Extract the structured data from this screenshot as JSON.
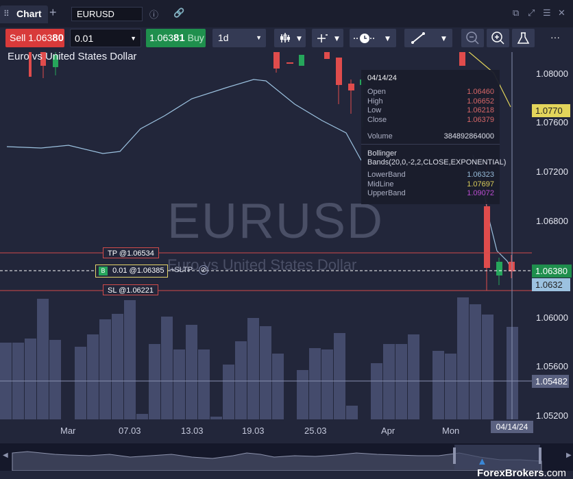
{
  "window": {
    "tab_title": "Chart",
    "symbol": "EURUSD",
    "info_icon": "info-icon",
    "link_icon": "link-icon"
  },
  "toolbar": {
    "sell_label": "Sell",
    "sell_price_main": "1.063",
    "sell_price_pips": "80",
    "quantity": "0.01",
    "buy_price_main": "1.063",
    "buy_price_pips": "81",
    "buy_label": "Buy",
    "timeframe": "1d",
    "more": "···"
  },
  "chart": {
    "title": "Euro vs United States Dollar",
    "watermark_symbol": "EURUSD",
    "watermark_name": "Euro vs United States Dollar",
    "tp_label": "TP @1.06534",
    "position_badge": "B",
    "position_label": "0.01 @1.06385",
    "sltp_label": "+SLTP",
    "sl_label": "SL @1.06221",
    "y_axis": [
      "1.08000",
      "1.07600",
      "1.07200",
      "1.06800",
      "1.06000",
      "1.05600",
      "1.05200"
    ],
    "tags": {
      "midline": "1.0770",
      "price": "1.06380",
      "lower": "1.0632",
      "crosshair": "1.05482"
    },
    "x_axis": [
      "Mar",
      "07.03",
      "13.03",
      "19.03",
      "25.03",
      "Apr",
      "Mon"
    ],
    "crosshair_date": "04/14/24",
    "colors": {
      "up": "#26a65b",
      "down": "#e04c4c",
      "volume": "#444b6c",
      "band": "#9cc2e0",
      "midline": "#e3d55b"
    }
  },
  "tooltip": {
    "date": "04/14/24",
    "open_label": "Open",
    "open": "1.06460",
    "high_label": "High",
    "high": "1.06652",
    "low_label": "Low",
    "low": "1.06218",
    "close_label": "Close",
    "close": "1.06379",
    "volume_label": "Volume",
    "volume": "384892864000",
    "indicator_line1": "Bollinger",
    "indicator_line2": "Bands(20,0,-2,2,CLOSE,EXPONENTIAL)",
    "lower_label": "LowerBand",
    "lower": "1.06323",
    "mid_label": "MidLine",
    "mid": "1.07697",
    "upper_label": "UpperBand",
    "upper": "1.09072"
  },
  "footer": {
    "brand": "ForexBrokers",
    "brand_suffix": ".com"
  }
}
